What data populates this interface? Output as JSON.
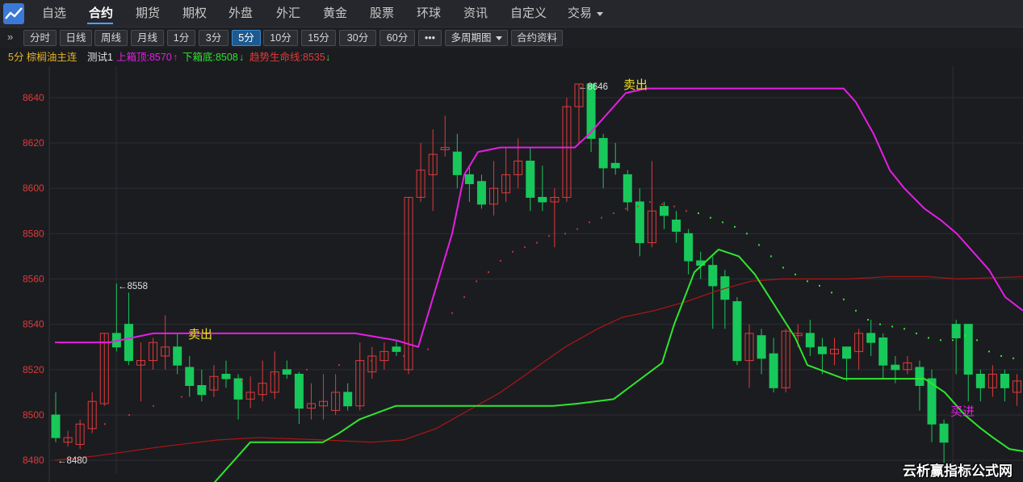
{
  "nav": {
    "items": [
      {
        "label": "自选",
        "active": false
      },
      {
        "label": "合约",
        "active": true
      },
      {
        "label": "期货",
        "active": false
      },
      {
        "label": "期权",
        "active": false
      },
      {
        "label": "外盘",
        "active": false
      },
      {
        "label": "外汇",
        "active": false
      },
      {
        "label": "黄金",
        "active": false
      },
      {
        "label": "股票",
        "active": false
      },
      {
        "label": "环球",
        "active": false
      },
      {
        "label": "资讯",
        "active": false
      },
      {
        "label": "自定义",
        "active": false
      },
      {
        "label": "交易",
        "active": false
      }
    ]
  },
  "toolbar": {
    "expand": "»",
    "buttons": [
      {
        "label": "分时",
        "active": false
      },
      {
        "label": "日线",
        "active": false
      },
      {
        "label": "周线",
        "active": false
      },
      {
        "label": "月线",
        "active": false
      },
      {
        "label": "1分",
        "active": false
      },
      {
        "label": "3分",
        "active": false
      },
      {
        "label": "5分",
        "active": true
      },
      {
        "label": "10分",
        "active": false
      },
      {
        "label": "15分",
        "active": false
      },
      {
        "label": "30分",
        "active": false
      },
      {
        "label": "60分",
        "active": false
      },
      {
        "label": "•••",
        "active": false
      },
      {
        "label": "多周期图",
        "active": false
      },
      {
        "label": "合约资料",
        "active": false
      }
    ]
  },
  "info": {
    "period_symbol": "5分 棕榈油主连",
    "indicator": "测试1",
    "upper_box": "上箱顶:8570",
    "upper_arrow": "↑",
    "lower_box": "下箱底:8508",
    "lower_arrow": "↓",
    "lifeline": "趋势生命线:8535",
    "lifeline_arrow": "↓"
  },
  "colors": {
    "up": "#e03b3b",
    "down": "#18c85a",
    "upper_box": "#e51ee5",
    "lower_box": "#2ee62e",
    "lifeline": "#b01515",
    "dots": "#c03030",
    "signal_sell": "#f0e020",
    "signal_buy": "#e51ee5"
  },
  "watermark": "云析赢指标公式网",
  "chart_data": {
    "type": "candlestick",
    "ylim": [
      8474,
      8651
    ],
    "y_ticks": [
      8480,
      8500,
      8520,
      8540,
      8560,
      8580,
      8600,
      8620,
      8640
    ],
    "candles": [
      [
        8500,
        8490,
        8510,
        8488
      ],
      [
        8488,
        8490,
        8493,
        8486
      ],
      [
        8487,
        8496,
        8498,
        8485
      ],
      [
        8494,
        8506,
        8510,
        8492
      ],
      [
        8505,
        8536,
        8536,
        8504
      ],
      [
        8536,
        8530,
        8558,
        8528
      ],
      [
        8540,
        8524,
        8554,
        8522
      ],
      [
        8522,
        8524,
        8532,
        8506
      ],
      [
        8524,
        8532,
        8534,
        8520
      ],
      [
        8526,
        8530,
        8544,
        8520
      ],
      [
        8530,
        8522,
        8536,
        8518
      ],
      [
        8521,
        8513,
        8526,
        8508
      ],
      [
        8513,
        8509,
        8520,
        8506
      ],
      [
        8511,
        8517,
        8522,
        8508
      ],
      [
        8518,
        8516,
        8524,
        8512
      ],
      [
        8516,
        8507,
        8518,
        8498
      ],
      [
        8507,
        8510,
        8517,
        8503
      ],
      [
        8509,
        8514,
        8524,
        8506
      ],
      [
        8510,
        8519,
        8528,
        8507
      ],
      [
        8520,
        8518,
        8524,
        8516
      ],
      [
        8518,
        8503,
        8519,
        8496
      ],
      [
        8503,
        8505,
        8514,
        8498
      ],
      [
        8504,
        8506,
        8518,
        8498
      ],
      [
        8502,
        8510,
        8518,
        8500
      ],
      [
        8510,
        8504,
        8514,
        8502
      ],
      [
        8504,
        8524,
        8532,
        8502
      ],
      [
        8519,
        8526,
        8530,
        8516
      ],
      [
        8524,
        8528,
        8532,
        8520
      ],
      [
        8530,
        8528,
        8533,
        8526
      ],
      [
        8520,
        8596,
        8596,
        8518
      ],
      [
        8596,
        8608,
        8620,
        8594
      ],
      [
        8606,
        8615,
        8626,
        8590
      ],
      [
        8617,
        8618,
        8632,
        8614
      ],
      [
        8616,
        8606,
        8624,
        8600
      ],
      [
        8606,
        8602,
        8610,
        8594
      ],
      [
        8603,
        8593,
        8606,
        8591
      ],
      [
        8593,
        8600,
        8612,
        8588
      ],
      [
        8598,
        8606,
        8618,
        8594
      ],
      [
        8606,
        8612,
        8622,
        8600
      ],
      [
        8612,
        8596,
        8618,
        8590
      ],
      [
        8596,
        8594,
        8610,
        8590
      ],
      [
        8594,
        8596,
        8600,
        8574
      ],
      [
        8596,
        8636,
        8640,
        8594
      ],
      [
        8636,
        8646,
        8646,
        8620
      ],
      [
        8646,
        8622,
        8646,
        8616
      ],
      [
        8622,
        8609,
        8624,
        8600
      ],
      [
        8611,
        8609,
        8620,
        8606
      ],
      [
        8606,
        8594,
        8608,
        8590
      ],
      [
        8594,
        8576,
        8600,
        8570
      ],
      [
        8576,
        8590,
        8612,
        8574
      ],
      [
        8592,
        8588,
        8594,
        8582
      ],
      [
        8586,
        8581,
        8590,
        8576
      ],
      [
        8580,
        8568,
        8582,
        8562
      ],
      [
        8568,
        8566,
        8572,
        8560
      ],
      [
        8566,
        8557,
        8570,
        8538
      ],
      [
        8561,
        8551,
        8564,
        8538
      ],
      [
        8550,
        8524,
        8552,
        8522
      ],
      [
        8524,
        8536,
        8540,
        8512
      ],
      [
        8535,
        8525,
        8538,
        8518
      ],
      [
        8527,
        8512,
        8534,
        8510
      ],
      [
        8512,
        8537,
        8538,
        8510
      ],
      [
        8535,
        8536,
        8540,
        8530
      ],
      [
        8536,
        8530,
        8542,
        8526
      ],
      [
        8530,
        8527,
        8534,
        8518
      ],
      [
        8527,
        8529,
        8534,
        8522
      ],
      [
        8530,
        8525,
        8530,
        8515
      ],
      [
        8528,
        8536,
        8538,
        8520
      ],
      [
        8536,
        8532,
        8542,
        8526
      ],
      [
        8534,
        8522,
        8536,
        8516
      ],
      [
        8522,
        8520,
        8526,
        8514
      ],
      [
        8520,
        8523,
        8526,
        8518
      ],
      [
        8521,
        8513,
        8524,
        8502
      ],
      [
        8516,
        8496,
        8520,
        8488
      ],
      [
        8496,
        8488,
        8498,
        8479
      ],
      [
        8540,
        8534,
        8542,
        8518
      ],
      [
        8540,
        8518,
        8540,
        8506
      ],
      [
        8518,
        8512,
        8520,
        8506
      ],
      [
        8512,
        8518,
        8522,
        8508
      ],
      [
        8518,
        8512,
        8520,
        8506
      ],
      [
        8510,
        8515,
        8518,
        8504
      ]
    ],
    "upper_box": [
      [
        68,
        8532
      ],
      [
        135,
        8532
      ],
      [
        190,
        8536
      ],
      [
        440,
        8536
      ],
      [
        490,
        8533
      ],
      [
        518,
        8530
      ],
      [
        560,
        8580
      ],
      [
        575,
        8606
      ],
      [
        592,
        8616
      ],
      [
        620,
        8618
      ],
      [
        712,
        8618
      ],
      [
        730,
        8624
      ],
      [
        775,
        8642
      ],
      [
        800,
        8644
      ],
      [
        1045,
        8644
      ],
      [
        1060,
        8638
      ],
      [
        1082,
        8624
      ],
      [
        1102,
        8608
      ],
      [
        1120,
        8600
      ],
      [
        1145,
        8591
      ],
      [
        1165,
        8586
      ],
      [
        1185,
        8580
      ],
      [
        1205,
        8572
      ],
      [
        1225,
        8564
      ],
      [
        1245,
        8552
      ],
      [
        1267,
        8546
      ]
    ],
    "lower_box": [
      [
        265,
        8470
      ],
      [
        310,
        8488
      ],
      [
        400,
        8488
      ],
      [
        420,
        8492
      ],
      [
        445,
        8498
      ],
      [
        490,
        8504
      ],
      [
        685,
        8504
      ],
      [
        715,
        8505
      ],
      [
        760,
        8507
      ],
      [
        790,
        8515
      ],
      [
        820,
        8523
      ],
      [
        835,
        8540
      ],
      [
        860,
        8563
      ],
      [
        890,
        8573
      ],
      [
        915,
        8570
      ],
      [
        935,
        8562
      ],
      [
        960,
        8548
      ],
      [
        985,
        8534
      ],
      [
        1000,
        8522
      ],
      [
        1045,
        8516
      ],
      [
        1145,
        8516
      ],
      [
        1170,
        8510
      ],
      [
        1195,
        8500
      ],
      [
        1215,
        8494
      ],
      [
        1230,
        8490
      ],
      [
        1250,
        8485
      ],
      [
        1267,
        8484
      ]
    ],
    "lifeline": [
      [
        68,
        8480
      ],
      [
        120,
        8482
      ],
      [
        200,
        8486
      ],
      [
        270,
        8489
      ],
      [
        320,
        8490
      ],
      [
        400,
        8489
      ],
      [
        460,
        8488
      ],
      [
        500,
        8489
      ],
      [
        540,
        8494
      ],
      [
        580,
        8502
      ],
      [
        620,
        8510
      ],
      [
        660,
        8520
      ],
      [
        700,
        8530
      ],
      [
        740,
        8538
      ],
      [
        770,
        8543
      ],
      [
        810,
        8546
      ],
      [
        850,
        8550
      ],
      [
        890,
        8555
      ],
      [
        930,
        8559
      ],
      [
        970,
        8560
      ],
      [
        1050,
        8560
      ],
      [
        1100,
        8561
      ],
      [
        1150,
        8561
      ],
      [
        1185,
        8560
      ],
      [
        1267,
        8561
      ]
    ],
    "trail_dots": [
      [
        130,
        8496
      ],
      [
        160,
        8500
      ],
      [
        190,
        8504
      ],
      [
        225,
        8508
      ],
      [
        265,
        8512
      ],
      [
        300,
        8515
      ],
      [
        340,
        8518
      ],
      [
        380,
        8520
      ],
      [
        420,
        8522
      ],
      [
        460,
        8524
      ],
      [
        500,
        8526
      ],
      [
        530,
        8529
      ],
      [
        560,
        8545
      ],
      [
        575,
        8552
      ],
      [
        590,
        8559
      ],
      [
        605,
        8563
      ],
      [
        620,
        8568
      ],
      [
        635,
        8572
      ],
      [
        650,
        8574
      ],
      [
        665,
        8576
      ],
      [
        680,
        8579
      ],
      [
        700,
        8580
      ],
      [
        715,
        8582
      ],
      [
        730,
        8585
      ],
      [
        745,
        8587
      ],
      [
        760,
        8589
      ],
      [
        775,
        8591
      ],
      [
        790,
        8592
      ],
      [
        805,
        8594
      ],
      [
        820,
        8593
      ],
      [
        835,
        8592
      ],
      [
        850,
        8590
      ],
      [
        865,
        8589
      ],
      [
        880,
        8587
      ],
      [
        895,
        8585
      ],
      [
        910,
        8583
      ],
      [
        925,
        8580
      ],
      [
        940,
        8575
      ],
      [
        955,
        8570
      ],
      [
        970,
        8565
      ],
      [
        985,
        8562
      ],
      [
        1000,
        8559
      ],
      [
        1015,
        8557
      ],
      [
        1030,
        8554
      ],
      [
        1045,
        8551
      ],
      [
        1060,
        8546
      ],
      [
        1075,
        8542
      ],
      [
        1090,
        8540
      ],
      [
        1105,
        8539
      ],
      [
        1120,
        8538
      ],
      [
        1135,
        8536
      ],
      [
        1150,
        8534
      ],
      [
        1165,
        8533
      ],
      [
        1180,
        8533
      ],
      [
        1195,
        8535
      ],
      [
        1210,
        8533
      ],
      [
        1225,
        8528
      ],
      [
        1240,
        8526
      ],
      [
        1255,
        8525
      ]
    ],
    "annotations": [
      {
        "text": "←8558",
        "price": 8557,
        "x": 146,
        "color": "#e0e0e0"
      },
      {
        "text": "←8480",
        "price": 8480,
        "x": 71,
        "color": "#e0e0e0"
      },
      {
        "text": "←8646",
        "price": 8645,
        "x": 716,
        "color": "#e0e0e0"
      },
      {
        "text": "卖出",
        "price": 8536,
        "x": 233,
        "color": "#f0e020"
      },
      {
        "text": "卖出",
        "price": 8646,
        "x": 772,
        "color": "#f0e020"
      },
      {
        "text": "买进",
        "price": 8502,
        "x": 1177,
        "color": "#e51ee5"
      }
    ]
  }
}
